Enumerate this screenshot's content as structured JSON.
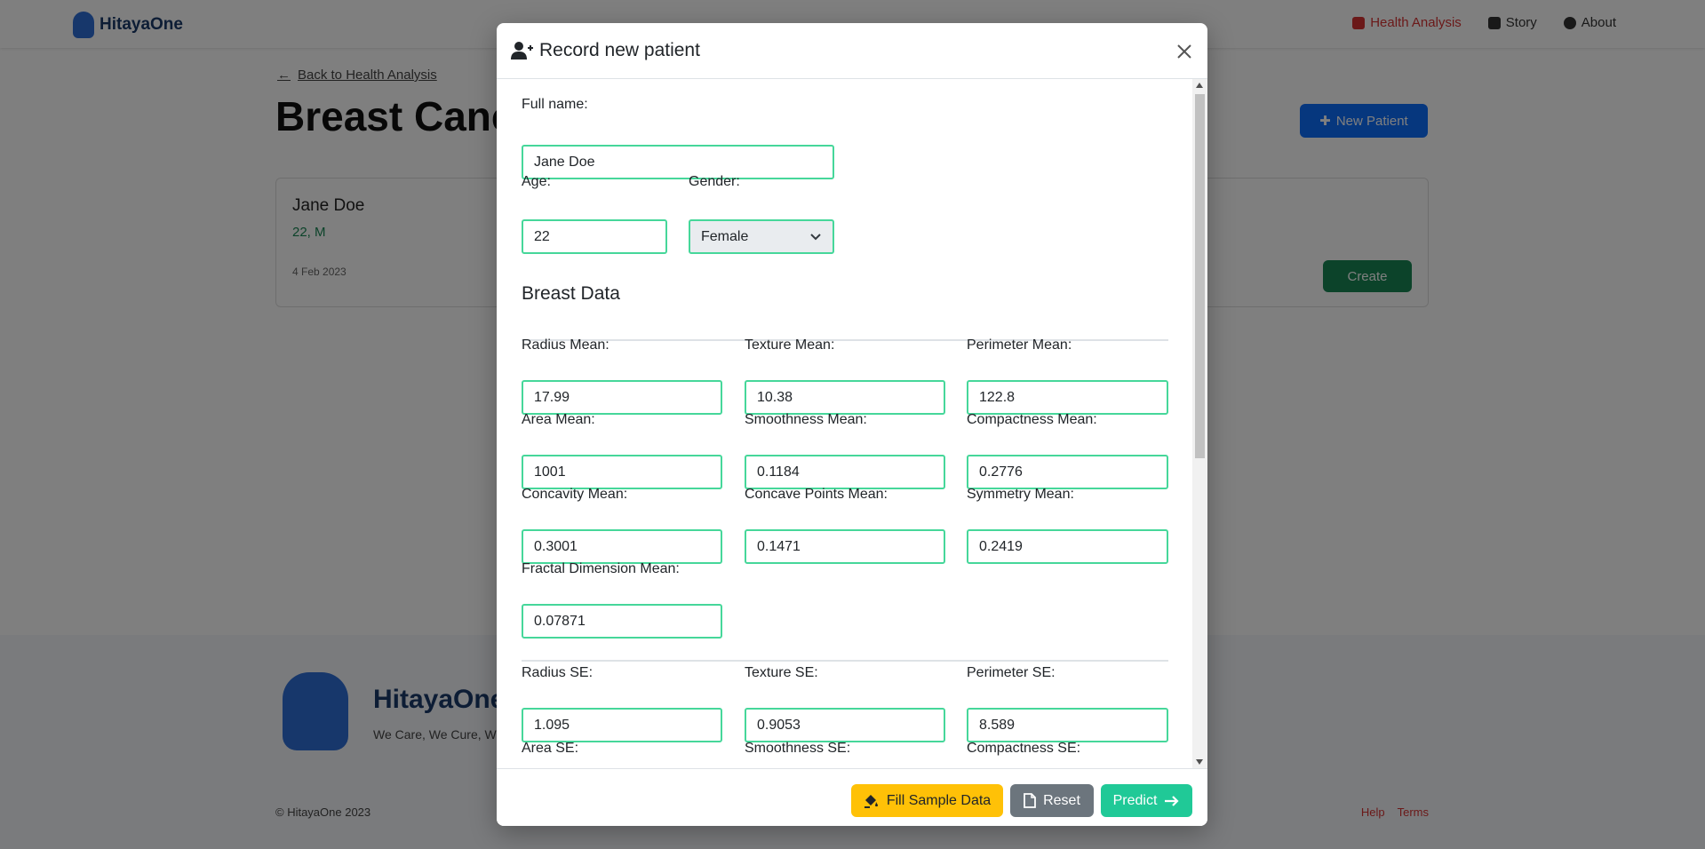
{
  "navbar": {
    "brand": "HitayaOne",
    "links": [
      {
        "label": "Health Analysis",
        "icon": "heart-icon"
      },
      {
        "label": "Story",
        "icon": "book-icon"
      },
      {
        "label": "About",
        "icon": "info-icon"
      }
    ]
  },
  "page": {
    "back_link": "Back to Health Analysis",
    "title": "Breast Cancer",
    "new_patient_button": "New Patient"
  },
  "patient_card": {
    "name": "Jane Doe",
    "age": "22, M",
    "date": "4 Feb 2023",
    "action": "Create"
  },
  "footer": {
    "brand": "HitayaOne",
    "tagline": "We Care, We Cure, We Connect",
    "copyright": "© HitayaOne 2023",
    "links": [
      "Help",
      "Terms"
    ]
  },
  "modal": {
    "title": "Record new patient",
    "full_name_label": "Full name:",
    "full_name_value": "Jane Doe",
    "age_label": "Age:",
    "age_value": "22",
    "gender_label": "Gender:",
    "gender_value": "Female",
    "section_title": "Breast Data",
    "mean_fields": [
      {
        "label": "Radius Mean:",
        "value": "17.99"
      },
      {
        "label": "Texture Mean:",
        "value": "10.38"
      },
      {
        "label": "Perimeter Mean:",
        "value": "122.8"
      },
      {
        "label": "Area Mean:",
        "value": "1001"
      },
      {
        "label": "Smoothness Mean:",
        "value": "0.1184"
      },
      {
        "label": "Compactness Mean:",
        "value": "0.2776"
      },
      {
        "label": "Concavity Mean:",
        "value": "0.3001"
      },
      {
        "label": "Concave Points Mean:",
        "value": "0.1471"
      },
      {
        "label": "Symmetry Mean:",
        "value": "0.2419"
      },
      {
        "label": "Fractal Dimension Mean:",
        "value": "0.07871"
      }
    ],
    "se_fields": [
      {
        "label": "Radius SE:",
        "value": "1.095"
      },
      {
        "label": "Texture SE:",
        "value": "0.9053"
      },
      {
        "label": "Perimeter SE:",
        "value": "8.589"
      },
      {
        "label": "Area SE:",
        "value": ""
      },
      {
        "label": "Smoothness SE:",
        "value": ""
      },
      {
        "label": "Compactness SE:",
        "value": ""
      }
    ],
    "buttons": {
      "fill": "Fill Sample Data",
      "reset": "Reset",
      "predict": "Predict"
    }
  },
  "colors": {
    "input_border": "#46d79a",
    "fill_button": "#ffc107",
    "reset_button": "#6c757d",
    "predict_button": "#20c997",
    "primary": "#0d6efd"
  }
}
